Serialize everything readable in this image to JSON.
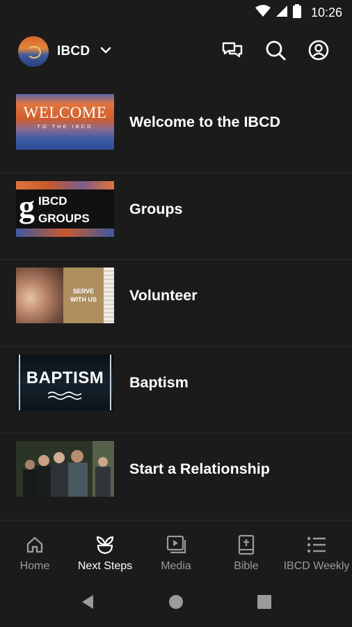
{
  "status_bar": {
    "time": "10:26"
  },
  "header": {
    "brand": "IBCD"
  },
  "list": {
    "items": [
      {
        "label": "Welcome to the IBCD",
        "thumb_line1": "WELCOME",
        "thumb_line2": "TO THE IBCD"
      },
      {
        "label": "Groups",
        "thumb_line1": "IBCD",
        "thumb_line2": "GROUPS"
      },
      {
        "label": "Volunteer",
        "thumb_line1": "SERVE",
        "thumb_line2": "WITH US"
      },
      {
        "label": "Baptism",
        "thumb_line1": "BAPTISM"
      },
      {
        "label": "Start a Relationship"
      }
    ]
  },
  "bottom_nav": {
    "items": [
      {
        "label": "Home",
        "icon": "home-icon"
      },
      {
        "label": "Next Steps",
        "icon": "sprout-icon",
        "active": true
      },
      {
        "label": "Media",
        "icon": "media-icon"
      },
      {
        "label": "Bible",
        "icon": "bible-icon"
      },
      {
        "label": "IBCD Weekly",
        "icon": "list-icon"
      }
    ]
  },
  "colors": {
    "background": "#1b1b1c",
    "inactive": "#9a9a9c",
    "active": "#ffffff"
  }
}
